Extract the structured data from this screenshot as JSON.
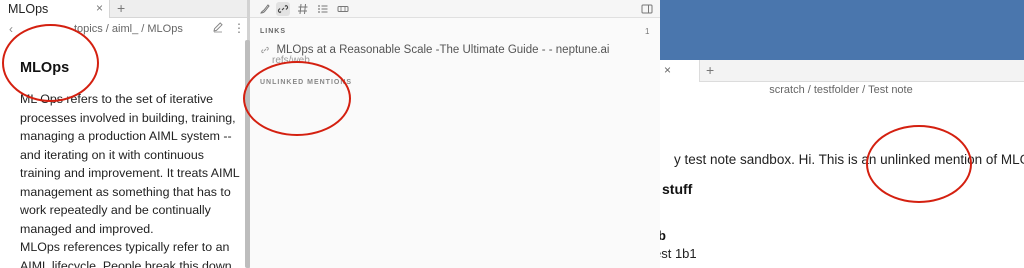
{
  "main_window": {
    "tab": {
      "title": "MLOps",
      "close_glyph": "×",
      "new_tab_glyph": "+"
    },
    "nav": {
      "back_glyph": "‹"
    },
    "breadcrumb": "topics / aiml_ / MLOps",
    "more_glyph": "⋮",
    "note": {
      "title": "MLOps",
      "paragraph1": "ML Ops refers to the set of iterative processes involved in building, training, managing a production AIML system -- and iterating on it with continuous training and improvement. It treats AIML management as something that has to work repeatedly and be continually managed and improved.",
      "paragraph2": "MLOps references typically refer to an AIML lifecycle. People break this down"
    }
  },
  "backlinks_panel": {
    "links_header": "LINKS",
    "links_count": "1",
    "links": [
      {
        "title": "MLOps at a Reasonable Scale -The Ultimate Guide - - neptune.ai",
        "path": "refs/web"
      }
    ],
    "unlinked_header": "UNLINKED MENTIONS"
  },
  "background_window": {
    "close_glyph": "×",
    "new_tab_glyph": "+",
    "breadcrumb": "scratch / testfolder / Test note",
    "text": "y test note sandbox. Hi. This is an unlinked mention of MLOps.",
    "heading": "stuff",
    "sub1": "b",
    "sub2": "est 1b1"
  },
  "colors": {
    "annotation": "#d42010",
    "desktop": "#4a76ad"
  },
  "icons": [
    "close-icon",
    "plus-icon",
    "back-icon",
    "edit-icon",
    "more-icon",
    "brush-icon",
    "link-icon",
    "hash-icon",
    "list-icon",
    "box-icon",
    "sidebar-toggle-icon"
  ]
}
